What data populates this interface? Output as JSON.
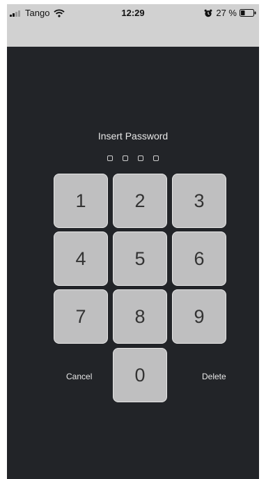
{
  "status_bar": {
    "carrier": "Tango",
    "time": "12:29",
    "battery": "27 %"
  },
  "lock_screen": {
    "title": "Insert Password",
    "pin_length": 4,
    "keys": [
      "1",
      "2",
      "3",
      "4",
      "5",
      "6",
      "7",
      "8",
      "9",
      "0"
    ],
    "cancel_label": "Cancel",
    "delete_label": "Delete"
  },
  "colors": {
    "background": "#222428",
    "key_fill": "#bfbfc0",
    "nav_bar": "#d1d1d1"
  },
  "icons": [
    "signal-icon",
    "wifi-icon",
    "alarm-icon",
    "battery-icon"
  ]
}
